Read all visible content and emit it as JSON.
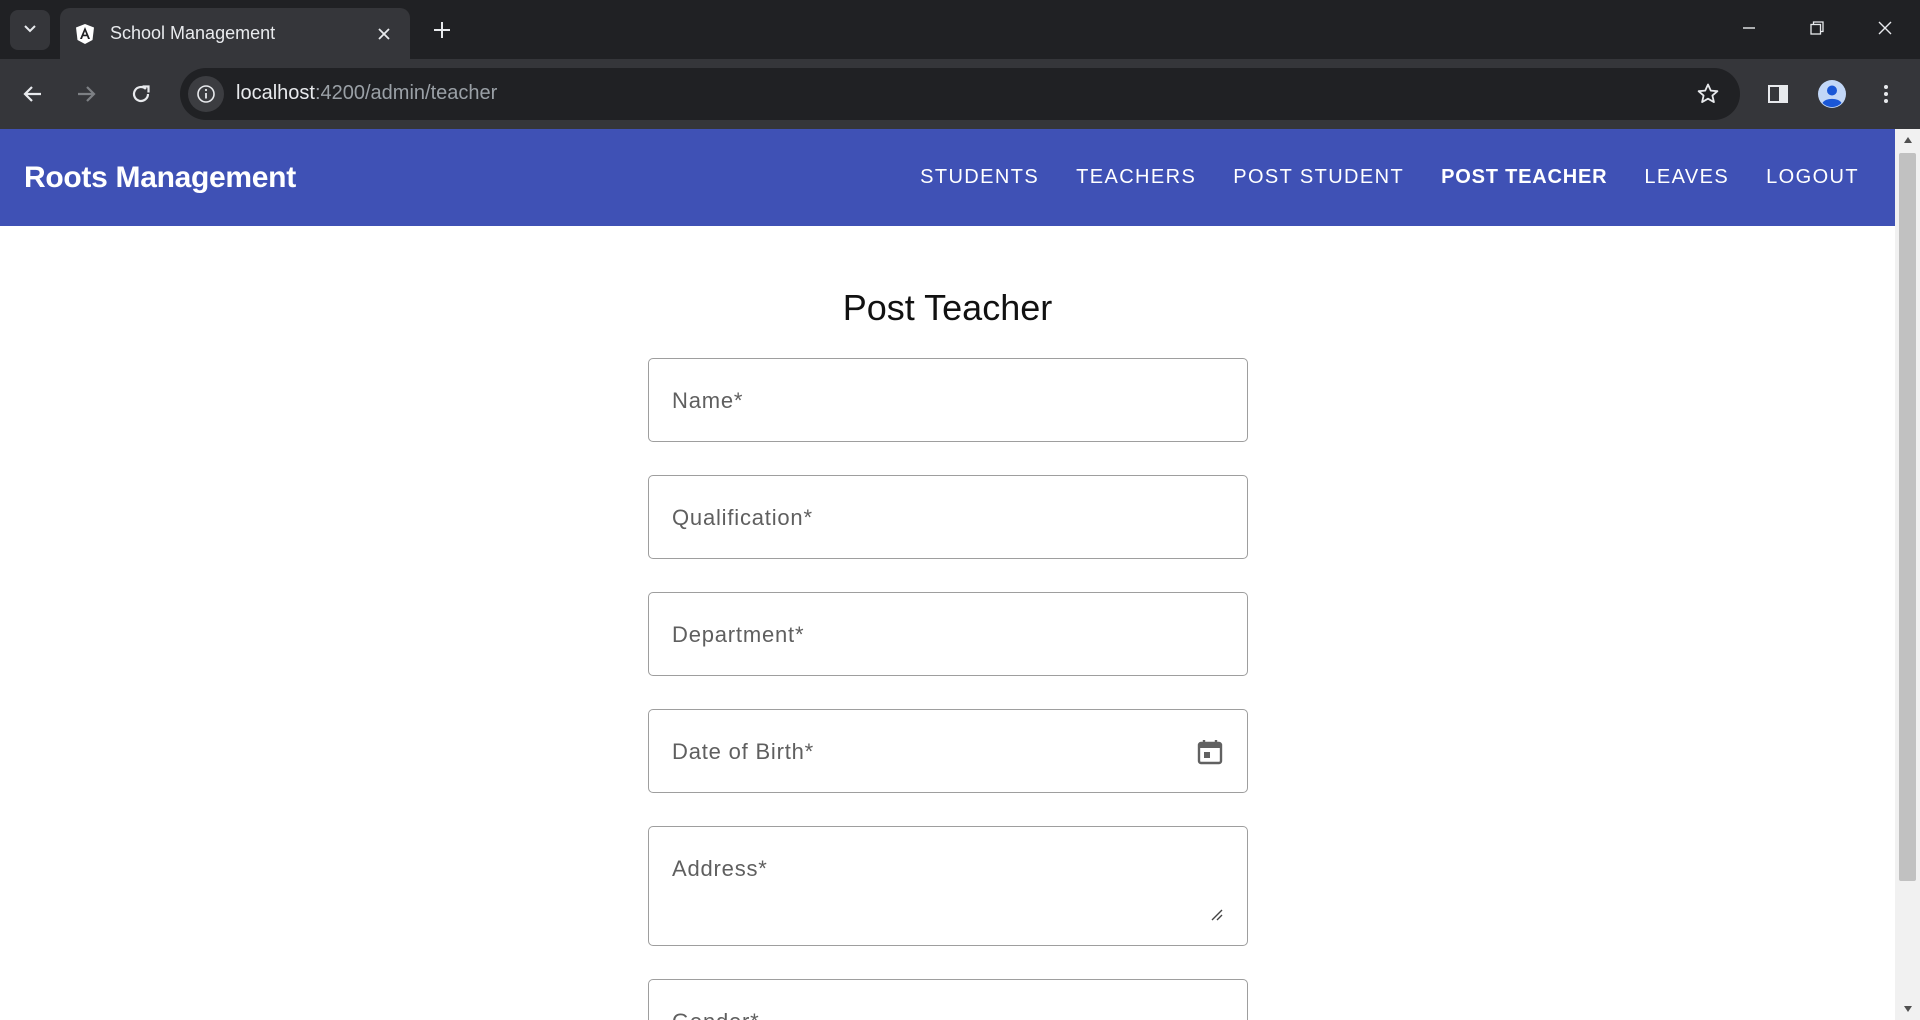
{
  "browser": {
    "tab_title": "School Management",
    "url_host": "localhost",
    "url_path": ":4200/admin/teacher",
    "icons": {
      "tab_search": "chevron-down-icon",
      "favicon": "angular-logo-icon",
      "tab_close": "close-icon",
      "new_tab": "plus-icon",
      "minimize": "minimize-icon",
      "restore": "restore-icon",
      "close_window": "close-icon",
      "back": "arrow-left-icon",
      "forward": "arrow-right-icon",
      "reload": "reload-icon",
      "site_info": "info-icon",
      "bookmark": "star-icon",
      "side_panel": "side-panel-icon",
      "profile": "profile-icon",
      "menu": "kebab-menu-icon"
    }
  },
  "app": {
    "brand": "Roots Management",
    "nav": [
      {
        "label": "STUDENTS"
      },
      {
        "label": "TEACHERS"
      },
      {
        "label": "POST STUDENT"
      },
      {
        "label": "POST TEACHER"
      },
      {
        "label": "LEAVES"
      },
      {
        "label": "LOGOUT"
      }
    ],
    "active_nav": "POST TEACHER",
    "colors": {
      "primary": "#3f51b5",
      "on_primary": "#ffffff"
    }
  },
  "form": {
    "title": "Post Teacher",
    "fields": [
      {
        "label": "Name*"
      },
      {
        "label": "Qualification*"
      },
      {
        "label": "Department*"
      },
      {
        "label": "Date of Birth*",
        "icon": "calendar-icon"
      },
      {
        "label": "Address*"
      },
      {
        "label": "Gender*",
        "icon": "dropdown-icon"
      }
    ]
  }
}
